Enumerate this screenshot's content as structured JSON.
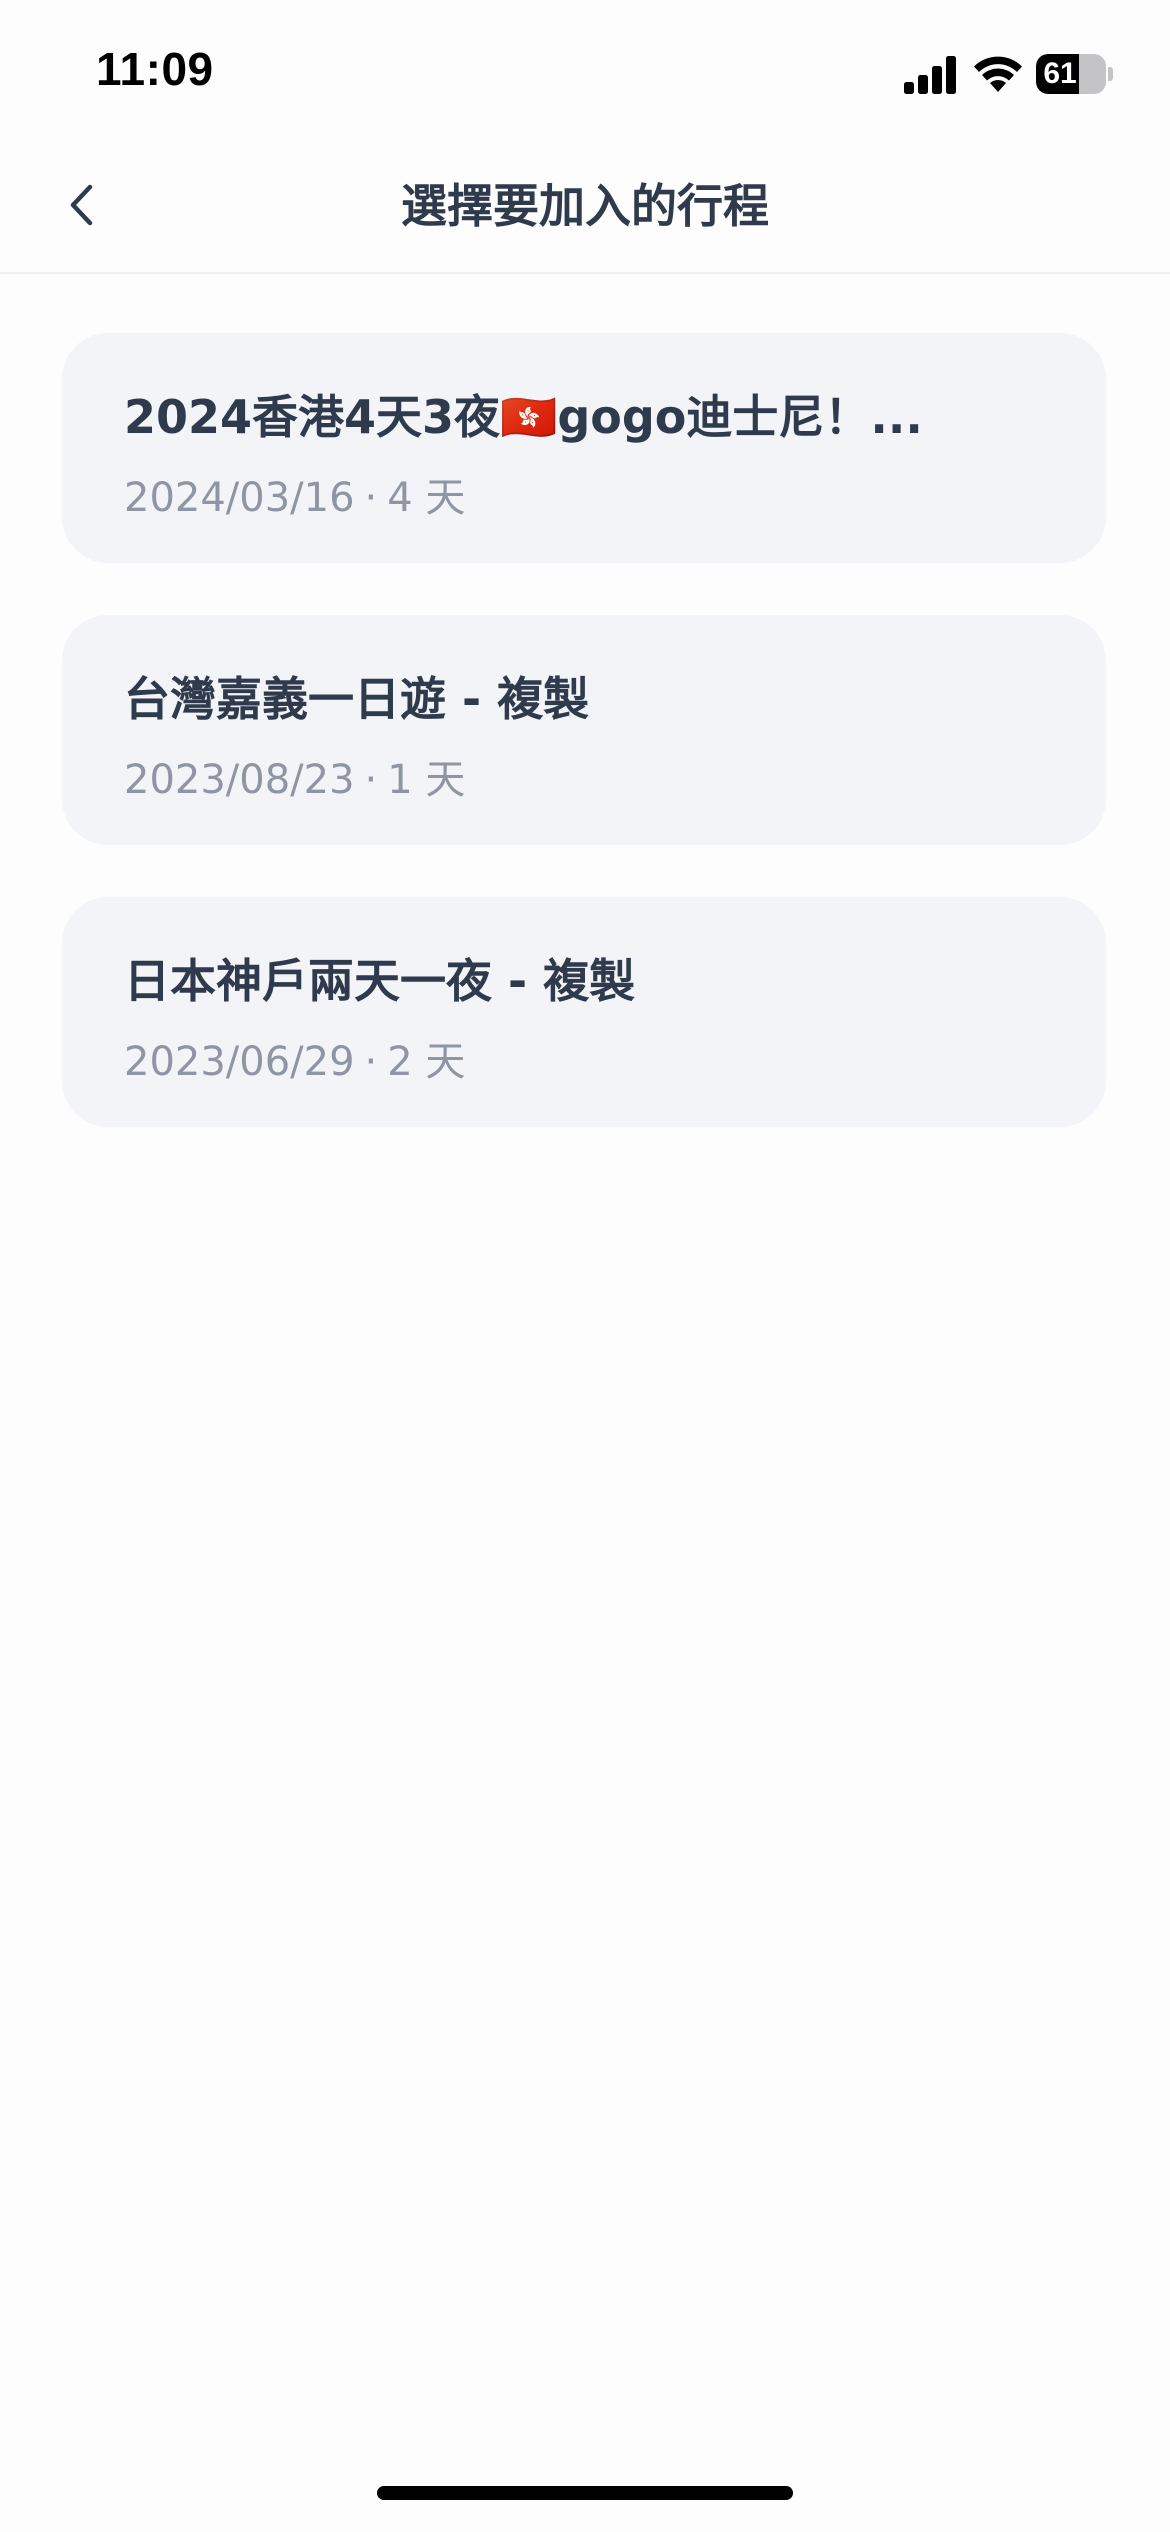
{
  "status_bar": {
    "time": "11:09",
    "battery_level": "61",
    "battery_fraction": 0.61
  },
  "header": {
    "title": "選擇要加入的行程",
    "back_icon": "chevron-left-icon"
  },
  "trips": [
    {
      "title": "2024香港4天3夜🇭🇰gogo迪士尼！...",
      "date": "2024/03/16",
      "separator": "·",
      "duration": "4 天"
    },
    {
      "title": "台灣嘉義一日遊 - 複製",
      "date": "2023/08/23",
      "separator": "·",
      "duration": "1 天"
    },
    {
      "title": "日本神戶兩天一夜 - 複製",
      "date": "2023/06/29",
      "separator": "·",
      "duration": "2 天"
    }
  ],
  "colors": {
    "title_text": "#2f3a4c",
    "meta_text": "#8e96a3",
    "card_background": "#f2f4f7",
    "page_background": "#fdfdfe"
  }
}
